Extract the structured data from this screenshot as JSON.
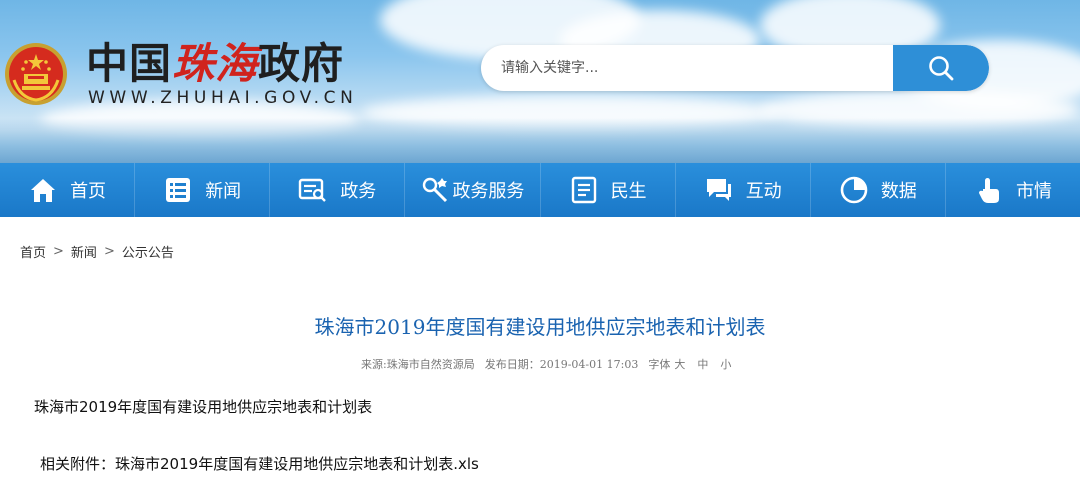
{
  "header": {
    "site_title_prefix": "中国",
    "site_title_city": "珠海",
    "site_title_suffix": "政府",
    "site_url": "WWW.ZHUHAI.GOV.CN",
    "emblem_icon": "national-emblem-icon",
    "accent_color": "#2e8fd7",
    "city_color": "#d0231d"
  },
  "search": {
    "placeholder": "请输入关键字...",
    "value": "",
    "button_icon": "search-icon"
  },
  "nav": {
    "items": [
      {
        "label": "首页",
        "icon": "home-icon"
      },
      {
        "label": "新闻",
        "icon": "news-icon"
      },
      {
        "label": "政务",
        "icon": "government-affairs-icon"
      },
      {
        "label": "政务服务",
        "icon": "service-icon"
      },
      {
        "label": "民生",
        "icon": "livelihood-icon"
      },
      {
        "label": "互动",
        "icon": "chat-icon"
      },
      {
        "label": "数据",
        "icon": "pie-chart-icon"
      },
      {
        "label": "市情",
        "icon": "touch-icon"
      }
    ]
  },
  "breadcrumb": {
    "items": [
      "首页",
      "新闻",
      "公示公告"
    ],
    "separator": ">"
  },
  "article": {
    "title": "珠海市2019年度国有建设用地供应宗地表和计划表",
    "source": "来源:珠海市自然资源局",
    "publish_date": "发布日期：2019-04-01 17:03",
    "font_size_label": "字体",
    "font_sizes": [
      "大",
      "中",
      "小"
    ],
    "body_heading": "珠海市2019年度国有建设用地供应宗地表和计划表",
    "attachment_label": "相关附件：",
    "attachment_name": "珠海市2019年度国有建设用地供应宗地表和计划表.xls"
  }
}
